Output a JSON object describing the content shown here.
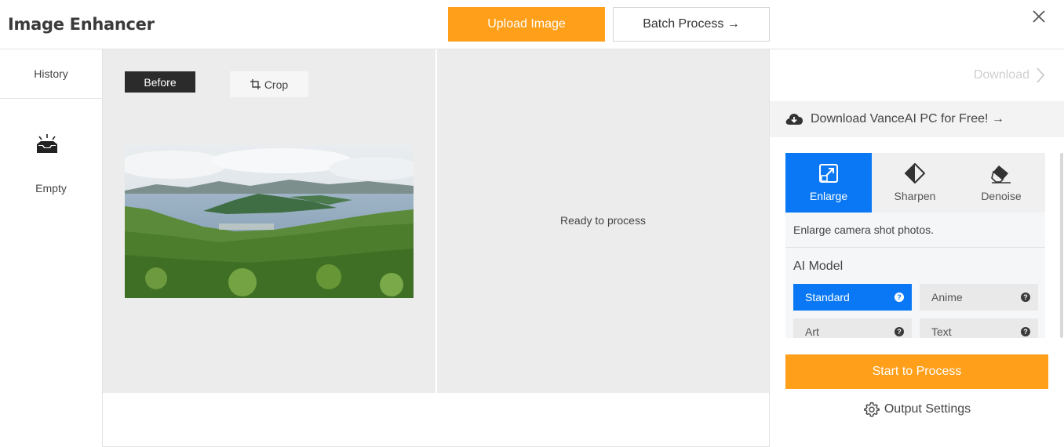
{
  "header": {
    "title": "Image Enhancer",
    "upload_label": "Upload Image",
    "batch_label": "Batch Process →"
  },
  "sidebar": {
    "history_label": "History",
    "empty_label": "Empty"
  },
  "canvas": {
    "before_label": "Before",
    "crop_label": "Crop",
    "ready_text": "Ready to process"
  },
  "panel": {
    "download_label": "Download",
    "pc_banner": "Download VanceAI PC for Free! →",
    "tabs": [
      {
        "label": "Enlarge",
        "icon": "enlarge-icon",
        "active": true
      },
      {
        "label": "Sharpen",
        "icon": "sharpen-icon",
        "active": false
      },
      {
        "label": "Denoise",
        "icon": "denoise-icon",
        "active": false
      }
    ],
    "description": "Enlarge camera shot photos.",
    "ai_model_label": "AI Model",
    "models": [
      {
        "label": "Standard",
        "active": true
      },
      {
        "label": "Anime",
        "active": false
      },
      {
        "label": "Art",
        "active": false
      },
      {
        "label": "Text",
        "active": false
      }
    ],
    "start_label": "Start to Process",
    "output_settings_label": "Output Settings"
  },
  "colors": {
    "accent_orange": "#ff9f1a",
    "accent_blue": "#0a78f5",
    "canvas_bg": "#ececec"
  }
}
